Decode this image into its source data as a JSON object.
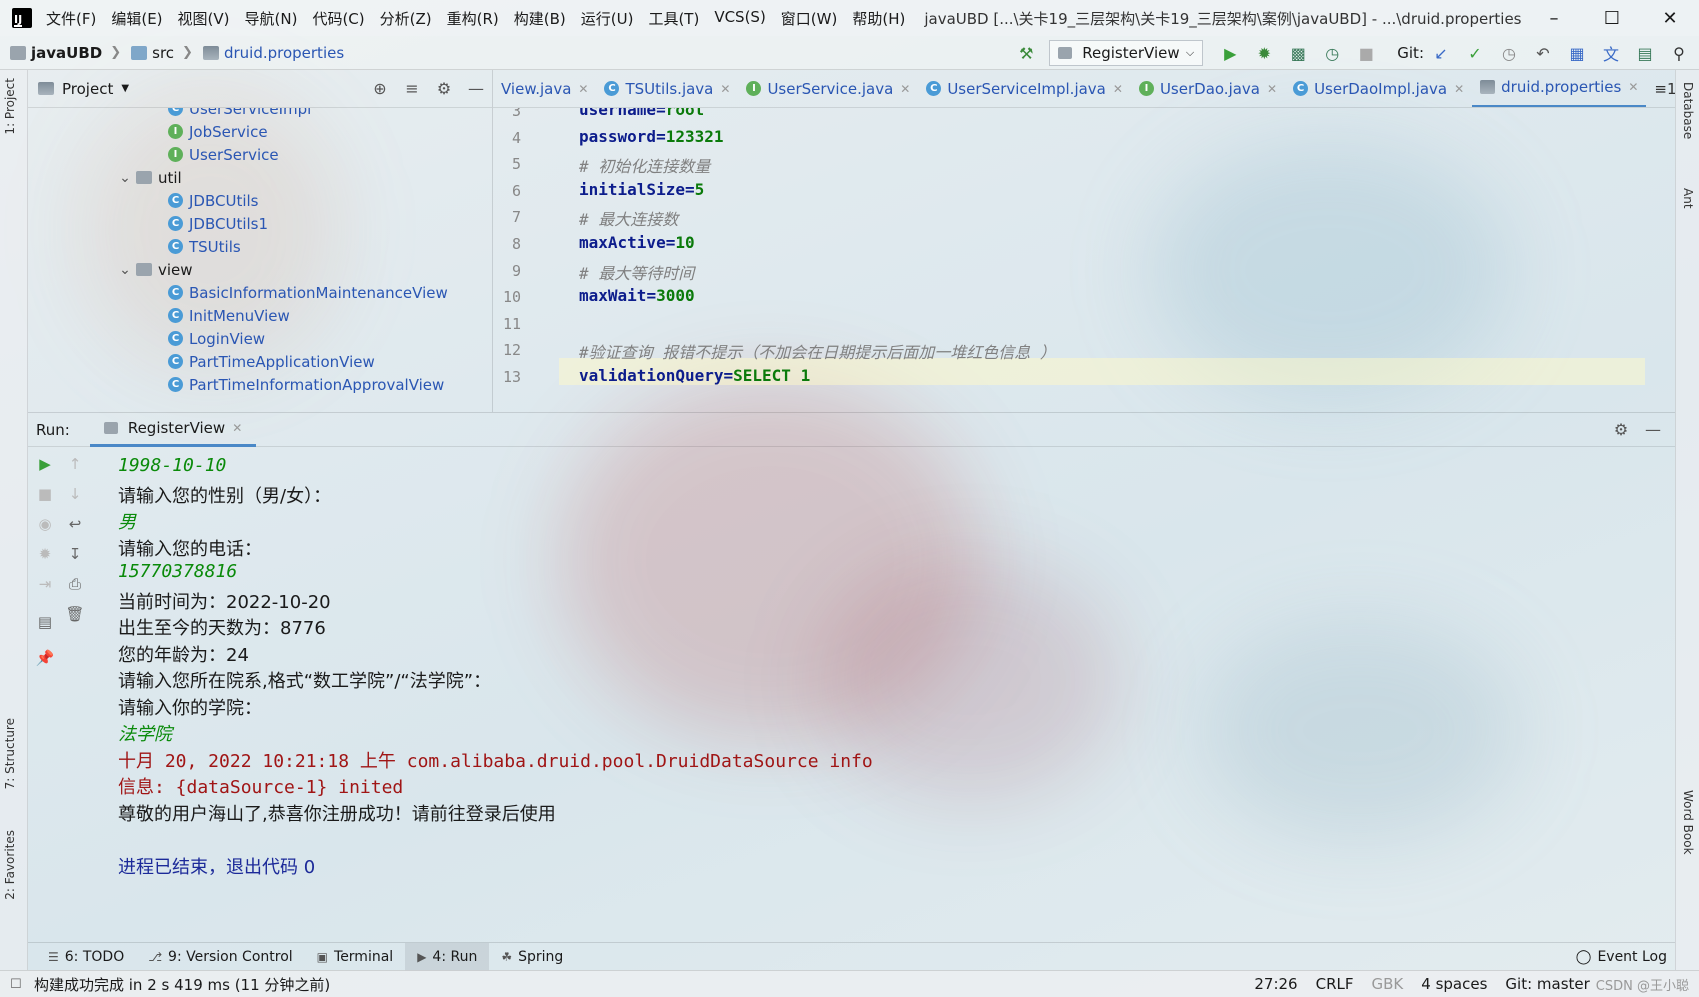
{
  "titlebar": {
    "logo": "IJ",
    "menu": [
      "文件(F)",
      "编辑(E)",
      "视图(V)",
      "导航(N)",
      "代码(C)",
      "分析(Z)",
      "重构(R)",
      "构建(B)",
      "运行(U)",
      "工具(T)",
      "VCS(S)",
      "窗口(W)",
      "帮助(H)"
    ],
    "title": "javaUBD [...\\关卡19_三层架构\\关卡19_三层架构\\案例\\javaUBD] - ...\\druid.properties"
  },
  "navbar": {
    "breadcrumbs": [
      "javaUBD",
      "src",
      "druid.properties"
    ],
    "run_config": "RegisterView",
    "git_label": "Git:"
  },
  "left_stripe": {
    "project": "1: Project",
    "structure": "7: Structure",
    "favorites": "2: Favorites"
  },
  "right_stripe": {
    "database": "Database",
    "ant": "Ant",
    "wordbook": "Word Book"
  },
  "project": {
    "title": "Project",
    "items": [
      {
        "type": "class",
        "name": "UserServiceImpl"
      },
      {
        "type": "interface",
        "name": "JobService"
      },
      {
        "type": "interface",
        "name": "UserService"
      },
      {
        "type": "package",
        "name": "util"
      },
      {
        "type": "class",
        "name": "JDBCUtils"
      },
      {
        "type": "class",
        "name": "JDBCUtils1"
      },
      {
        "type": "class",
        "name": "TSUtils"
      },
      {
        "type": "package",
        "name": "view"
      },
      {
        "type": "class",
        "name": "BasicInformationMaintenanceView"
      },
      {
        "type": "class",
        "name": "InitMenuView"
      },
      {
        "type": "class",
        "name": "LoginView"
      },
      {
        "type": "class",
        "name": "PartTimeApplicationView"
      },
      {
        "type": "class",
        "name": "PartTimeInformationApprovalView"
      }
    ]
  },
  "editor": {
    "tabs": [
      {
        "name": "View.java",
        "icon": "none"
      },
      {
        "name": "TSUtils.java",
        "icon": "class"
      },
      {
        "name": "UserService.java",
        "icon": "interface"
      },
      {
        "name": "UserServiceImpl.java",
        "icon": "class"
      },
      {
        "name": "UserDao.java",
        "icon": "interface"
      },
      {
        "name": "UserDaoImpl.java",
        "icon": "class"
      },
      {
        "name": "druid.properties",
        "icon": "properties"
      }
    ],
    "tab_overflow": "≡1",
    "lines": [
      {
        "n": "3",
        "key": "username",
        "eq": "=",
        "val": "root"
      },
      {
        "n": "4",
        "key": "password",
        "eq": "=",
        "val": "123321"
      },
      {
        "n": "5",
        "comment": "# 初始化连接数量"
      },
      {
        "n": "6",
        "key": "initialSize",
        "eq": "=",
        "val": "5"
      },
      {
        "n": "7",
        "comment": "# 最大连接数"
      },
      {
        "n": "8",
        "key": "maxActive",
        "eq": "=",
        "val": "10"
      },
      {
        "n": "9",
        "comment": "# 最大等待时间"
      },
      {
        "n": "10",
        "key": "maxWait",
        "eq": "=",
        "val": "3000"
      },
      {
        "n": "11"
      },
      {
        "n": "12",
        "comment": "#验证查询 报错不提示（不加会在日期提示后面加一堆红色信息 ）"
      },
      {
        "n": "13",
        "key": "validationQuery",
        "eq": "=",
        "val": "SELECT 1"
      }
    ]
  },
  "run": {
    "label": "Run:",
    "tab": "RegisterView",
    "console": [
      {
        "kind": "in",
        "text": "1998-10-10"
      },
      {
        "kind": "out",
        "text": "请输入您的性别（男/女）："
      },
      {
        "kind": "in",
        "text": "男"
      },
      {
        "kind": "out",
        "text": "请输入您的电话："
      },
      {
        "kind": "in",
        "text": "15770378816"
      },
      {
        "kind": "out",
        "text": "当前时间为：2022-10-20"
      },
      {
        "kind": "out",
        "text": "出生至今的天数为：8776"
      },
      {
        "kind": "out",
        "text": "您的年龄为：24"
      },
      {
        "kind": "out",
        "text": "请输入您所在院系,格式“数工学院”/“法学院”："
      },
      {
        "kind": "out",
        "text": "请输入你的学院："
      },
      {
        "kind": "in",
        "text": "法学院"
      },
      {
        "kind": "err",
        "text": "十月 20, 2022 10:21:18 上午 com.alibaba.druid.pool.DruidDataSource info"
      },
      {
        "kind": "err",
        "text": "信息: {dataSource-1} inited"
      },
      {
        "kind": "out",
        "text": "尊敬的用户海山了,恭喜你注册成功！请前往登录后使用"
      },
      {
        "kind": "blank",
        "text": ""
      },
      {
        "kind": "exit",
        "text": "进程已结束，退出代码 0"
      }
    ]
  },
  "tooltabs": [
    {
      "label": "6: TODO",
      "icon": "list-icon"
    },
    {
      "label": "9: Version Control",
      "icon": "vcs-icon"
    },
    {
      "label": "Terminal",
      "icon": "terminal-icon"
    },
    {
      "label": "4: Run",
      "icon": "run-icon",
      "active": true
    },
    {
      "label": "Spring",
      "icon": "spring-icon"
    }
  ],
  "event_log": "Event Log",
  "status": {
    "message": "构建成功完成 in 2 s 419 ms (11 分钟之前)",
    "position": "27:26",
    "line_sep": "CRLF",
    "encoding": "GBK",
    "indent": "4 spaces",
    "git": "Git: master",
    "watermark": "CSDN @王小聪"
  },
  "colors": {
    "accent": "#4a88c7",
    "key": "#0d1d8c",
    "value": "#0a7a0a",
    "console_input": "#0a8a0a",
    "console_error": "#a01515",
    "console_exit": "#1c2a99"
  }
}
